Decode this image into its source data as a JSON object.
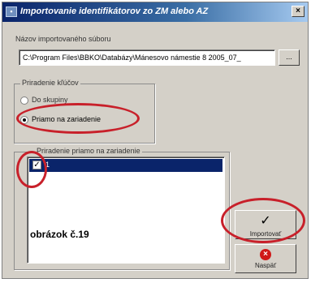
{
  "window": {
    "title": "Importovanie identifikátorov zo ZM alebo AZ",
    "close_glyph": "×"
  },
  "file": {
    "label": "Názov importovaného súboru",
    "value": "C:\\Program Files\\BBKO\\Databázy\\Mánesovo námestie 8 2005_07_",
    "browse_label": "..."
  },
  "assignment": {
    "group_title": "Priradenie kľúčov",
    "options": [
      {
        "label": "Do skupiny",
        "selected": false
      },
      {
        "label": "Priamo na zariadenie",
        "selected": true
      }
    ]
  },
  "device_list": {
    "group_title": "Priradenie priamo na zariadenie",
    "items": [
      {
        "label": "1",
        "checked": true
      }
    ]
  },
  "buttons": {
    "import_label": "Importovať",
    "import_icon": "checkmark-icon",
    "back_label": "Naspäť",
    "back_icon": "cancel-icon"
  },
  "caption": "obrázok č.19",
  "colors": {
    "titlebar_start": "#0a246a",
    "titlebar_end": "#a6caf0",
    "face": "#d4d0c8",
    "selection": "#0a246a",
    "annotation_oval": "#c8202a"
  }
}
